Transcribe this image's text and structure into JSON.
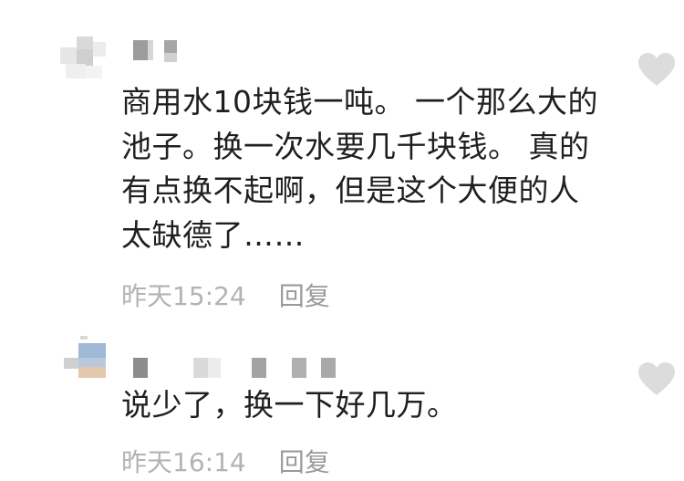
{
  "comments": [
    {
      "text_lines": [
        "商用水10块钱一吨。 一个那么大的",
        "池子。换一次水要几千块钱。 真的",
        "有点换不起啊，但是这个大便的人",
        "太缺德了……"
      ],
      "time": "昨天15:24",
      "reply_label": "回复",
      "like_icon": "heart-icon"
    },
    {
      "text_lines": [
        "说少了，换一下好几万。"
      ],
      "time": "昨天16:14",
      "reply_label": "回复",
      "like_icon": "heart-icon"
    }
  ],
  "colors": {
    "text": "#1f1f1f",
    "meta": "#b3b3b3",
    "like_icon": "#dcdcdc"
  }
}
